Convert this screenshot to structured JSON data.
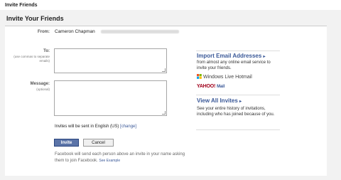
{
  "topbar": {
    "title": "Invite Friends"
  },
  "panel": {
    "title": "Invite Your Friends"
  },
  "form": {
    "from_label": "From:",
    "from_name": "Cameron Chapman",
    "to_label": "To:",
    "to_hint": "(use commas to separate emails)",
    "to_value": "",
    "message_label": "Message:",
    "message_hint": "(optional)",
    "message_value": "",
    "language_text": "Invites will be sent in English (US)",
    "language_link": "[change]",
    "invite_button": "Invite",
    "cancel_button": "Cancel",
    "note_text": "Facebook will send each person above an invite in your name asking them to join Facebook.",
    "note_link": "See Example"
  },
  "sidebar": {
    "import_title": "Import Email Addresses",
    "import_body": "from almost any online email service to invite your friends.",
    "hotmail_label": "Windows Live Hotmail",
    "yahoo_label": "YAHOO!",
    "yahoo_mail_label": "Mail",
    "view_title": "View All Invites",
    "view_body": "See your entire history of invitations, including who has joined because of you."
  },
  "colors": {
    "link": "#3b5998",
    "button": "#5b74a8"
  }
}
